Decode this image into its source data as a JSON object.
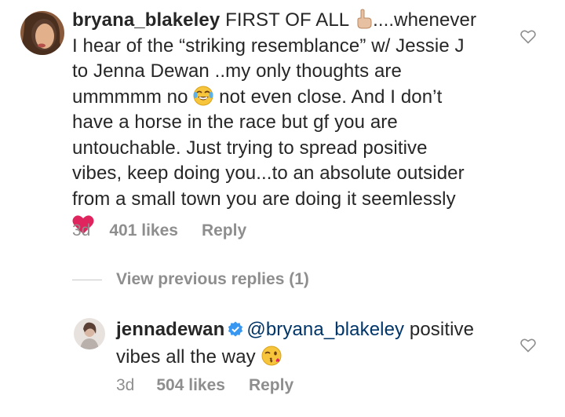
{
  "comment1": {
    "username": "bryana_blakeley",
    "text_lines": [
      "FIRST OF ALL",
      "....whenever",
      "I hear of the “striking resemblance” w/ Jessie J",
      "to Jenna Dewan ..my only thoughts are",
      "ummmmm no",
      "not even close. And I don’t",
      "have a horse in the race but gf you are",
      "untouchable. Just trying to spread positive",
      "vibes, keep doing you...to an absolute outsider",
      "from a small town you are doing it seemlessly"
    ],
    "emojis": [
      "pointing-up-emoji",
      "tears-of-joy-emoji",
      "red-heart-emoji"
    ],
    "time": "3d",
    "likes": "401 likes",
    "reply_label": "Reply"
  },
  "view_previous": "View previous replies (1)",
  "comment2": {
    "username": "jennadewan",
    "mention": "@bryana_blakeley",
    "text_line1": "positive",
    "text_line2": "vibes all the way",
    "emojis": [
      "kiss-wink-emoji"
    ],
    "time": "3d",
    "likes": "504 likes",
    "reply_label": "Reply"
  },
  "colors": {
    "text": "#262626",
    "meta": "#8e8e8e",
    "mention": "#003569",
    "verified": "#3897f0"
  }
}
